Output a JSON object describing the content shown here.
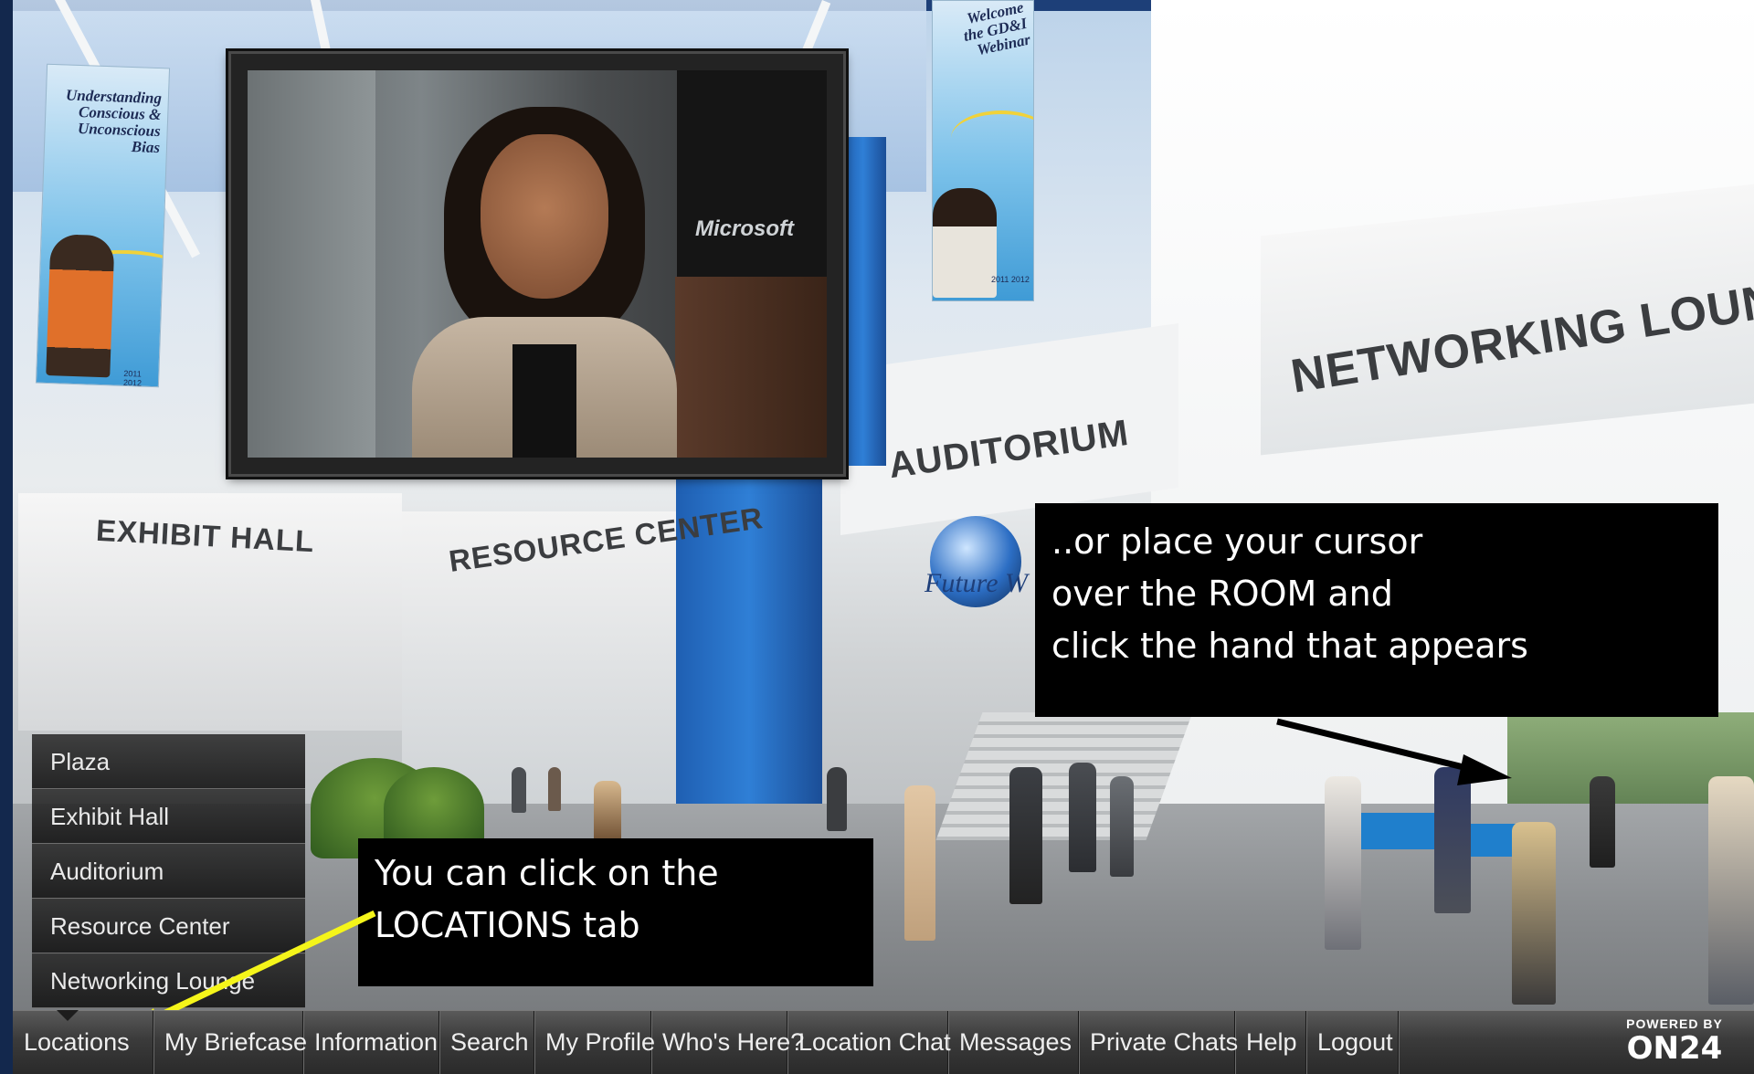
{
  "scene": {
    "banner_left_text": [
      "Understanding",
      "Conscious &",
      "Unconscious",
      "Bias"
    ],
    "banner_left_years": "2011 2012",
    "banner_right_text": [
      "Welcome",
      "the GD&I",
      "Webinar"
    ],
    "banner_right_years": "2011 2012",
    "sign_exhibit_hall": "EXHIBIT HALL",
    "sign_resource_center": "RESOURCE CENTER",
    "sign_auditorium": "AUDITORIUM",
    "sign_networking_lounge": "NETWORKING LOUNGE",
    "logo_text": "Future W",
    "video_brand": "Microsoft"
  },
  "callouts": {
    "locations_hint": [
      "You can click on the",
      "LOCATIONS tab"
    ],
    "room_hint": [
      "..or place your cursor",
      "over the ROOM  and",
      "click the hand that appears"
    ]
  },
  "locations_menu": {
    "items": [
      "Plaza",
      "Exhibit Hall",
      "Auditorium",
      "Resource Center",
      "Networking Lounge"
    ]
  },
  "bottom_bar": {
    "tabs": [
      "Locations",
      "My Briefcase",
      "Information",
      "Search",
      "My Profile",
      "Who's Here?",
      "Location Chat",
      "Messages",
      "Private Chats",
      "Help",
      "Logout"
    ],
    "powered_by": "POWERED BY",
    "brand": "ON24"
  },
  "colors": {
    "callout_bg": "#000000",
    "arrow_yellow": "#f5f51a",
    "bar_bg": "#3b3b3b"
  }
}
